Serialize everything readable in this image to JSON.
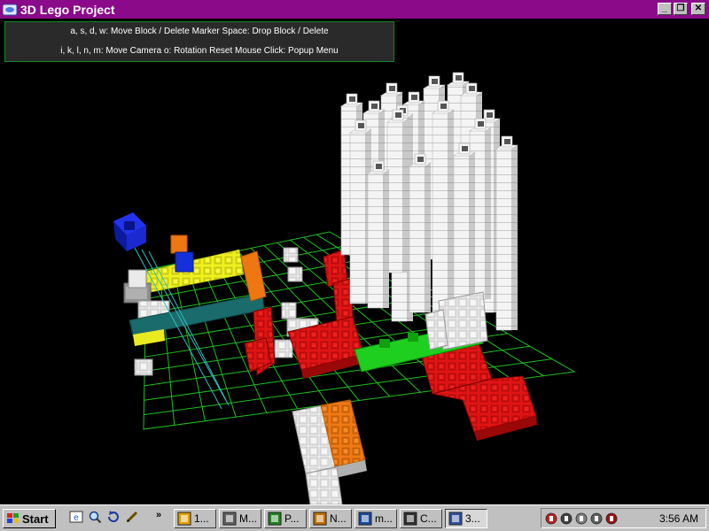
{
  "window": {
    "title": "3D Lego Project",
    "buttons": [
      "_",
      "❐",
      "✕"
    ]
  },
  "help": {
    "line1": "a, s, d, w: Move Block / Delete Marker  Space: Drop Block / Delete",
    "line2": "i, k, l, n, m: Move Camera  o: Rotation Reset  Mouse Click: Popup Menu"
  },
  "colors": {
    "grid": "#1fbf1f",
    "white": "#eeeeee",
    "red": "#dd1111",
    "green": "#1fcf1f",
    "yellow": "#eeee22",
    "orange": "#ee7711",
    "teal": "#1a6b6b",
    "blue": "#1122cc",
    "gray": "#999999"
  },
  "taskbar": {
    "start_label": "Start",
    "chevron": "»",
    "quick_launch": [
      "ie-icon",
      "search-icon",
      "refresh-icon",
      "pen-icon"
    ],
    "tasks": [
      {
        "label": "1...",
        "icon": "lightning-icon"
      },
      {
        "label": "M...",
        "icon": "gear-icon"
      },
      {
        "label": "P...",
        "icon": "trash-icon"
      },
      {
        "label": "N...",
        "icon": "grid-icon"
      },
      {
        "label": "m...",
        "icon": "magnifier-icon"
      },
      {
        "label": "C...",
        "icon": "console-icon"
      },
      {
        "label": "3...",
        "icon": "app-icon"
      }
    ],
    "tray_icons": [
      "shield-icon",
      "speaker-icon",
      "network-icon",
      "satellite-icon",
      "user-icon"
    ],
    "clock": "3:56 AM"
  }
}
